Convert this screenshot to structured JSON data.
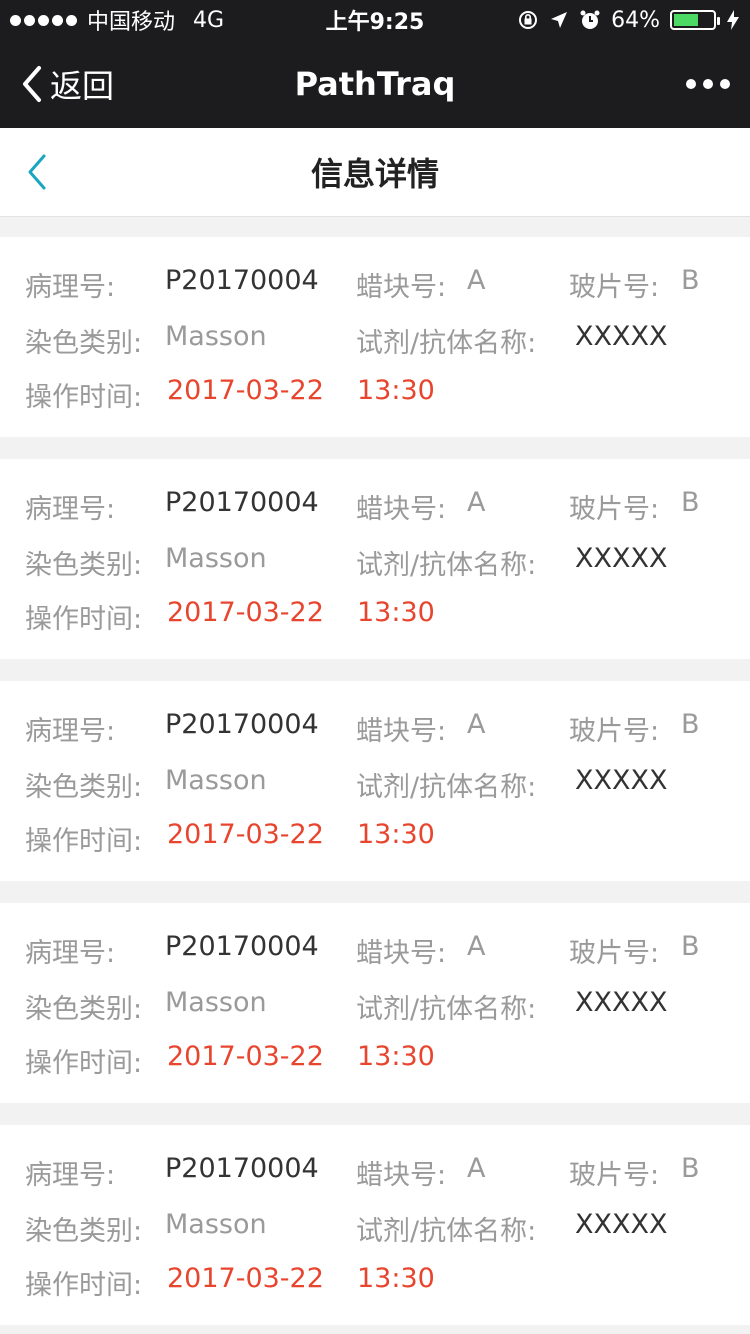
{
  "status_bar": {
    "carrier": "中国移动",
    "network": "4G",
    "time": "上午9:25",
    "battery_percent": "64%",
    "battery_level": 0.64
  },
  "nav": {
    "back_label": "返回",
    "title": "PathTraq"
  },
  "page": {
    "title": "信息详情"
  },
  "labels": {
    "pathology_no": "病理号:",
    "block_no": "蜡块号:",
    "slide_no": "玻片号:",
    "stain_type": "染色类别:",
    "reagent_name": "试剂/抗体名称:",
    "operation_time": "操作时间:"
  },
  "records": [
    {
      "pathology_no": "P20170004",
      "block_no": "A",
      "slide_no": "B",
      "stain_type": "Masson",
      "reagent_name": "XXXXX",
      "date": "2017-03-22",
      "time": "13:30"
    },
    {
      "pathology_no": "P20170004",
      "block_no": "A",
      "slide_no": "B",
      "stain_type": "Masson",
      "reagent_name": "XXXXX",
      "date": "2017-03-22",
      "time": "13:30"
    },
    {
      "pathology_no": "P20170004",
      "block_no": "A",
      "slide_no": "B",
      "stain_type": "Masson",
      "reagent_name": "XXXXX",
      "date": "2017-03-22",
      "time": "13:30"
    },
    {
      "pathology_no": "P20170004",
      "block_no": "A",
      "slide_no": "B",
      "stain_type": "Masson",
      "reagent_name": "XXXXX",
      "date": "2017-03-22",
      "time": "13:30"
    },
    {
      "pathology_no": "P20170004",
      "block_no": "A",
      "slide_no": "B",
      "stain_type": "Masson",
      "reagent_name": "XXXXX",
      "date": "2017-03-22",
      "time": "13:30"
    }
  ],
  "colors": {
    "bar_background": "#1c1c1e",
    "accent": "#1aa6c0",
    "time_red": "#e8452e",
    "battery_green": "#4cd964"
  }
}
